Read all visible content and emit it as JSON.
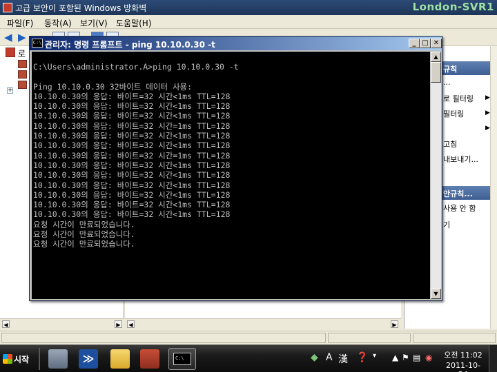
{
  "firewall": {
    "title": "고급 보안이 포함된 Windows 방화벽",
    "watermark": "London-SVR1",
    "menu": [
      "파일(F)",
      "동작(A)",
      "보기(V)",
      "도움말(H)"
    ],
    "tree_root_label": "로",
    "actions": {
      "header1": "규칙",
      "items1": [
        "...",
        "로 필터링",
        "필터링",
        "",
        "고침",
        "내보내기..."
      ],
      "header2": "안규칙...",
      "items2": [
        "사용 안 함",
        "기"
      ]
    }
  },
  "cmd": {
    "title": "관리자: 명령 프롬프트 - ping  10.10.0.30 -t",
    "icon_text": "C:\\",
    "lines": [
      "C:\\Users\\administrator.A>ping 10.10.0.30 -t",
      "",
      "Ping 10.10.0.30 32바이트 데이터 사용:",
      "10.10.0.30의 응답: 바이트=32 시간<1ms TTL=128",
      "10.10.0.30의 응답: 바이트=32 시간<1ms TTL=128",
      "10.10.0.30의 응답: 바이트=32 시간<1ms TTL=128",
      "10.10.0.30의 응답: 바이트=32 시간=1ms TTL=128",
      "10.10.0.30의 응답: 바이트=32 시간<1ms TTL=128",
      "10.10.0.30의 응답: 바이트=32 시간<1ms TTL=128",
      "10.10.0.30의 응답: 바이트=32 시간=1ms TTL=128",
      "10.10.0.30의 응답: 바이트=32 시간<1ms TTL=128",
      "10.10.0.30의 응답: 바이트=32 시간<1ms TTL=128",
      "10.10.0.30의 응답: 바이트=32 시간<1ms TTL=128",
      "10.10.0.30의 응답: 바이트=32 시간<1ms TTL=128",
      "10.10.0.30의 응답: 바이트=32 시간<1ms TTL=128",
      "10.10.0.30의 응답: 바이트=32 시간<1ms TTL=128",
      "요청 시간이 만료되었습니다.",
      "요청 시간이 만료되었습니다.",
      "요청 시간이 만료되었습니다."
    ]
  },
  "taskbar": {
    "start_label": "시작",
    "ime_mode": "A",
    "ime_hanja": "漢",
    "time": "오전 11:02",
    "date": "2011-10-24"
  },
  "icons": {
    "firewall_app": "firewall-shield-icon",
    "cmd_app": "command-prompt-icon"
  }
}
